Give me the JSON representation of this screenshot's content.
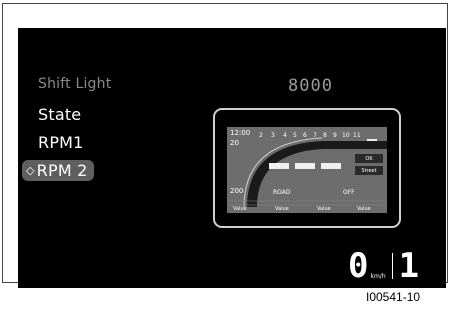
{
  "menu": {
    "items": [
      {
        "label": "Shift Light",
        "state": "dim"
      },
      {
        "label": "State",
        "state": "normal"
      },
      {
        "label": "RPM1",
        "state": "normal"
      },
      {
        "label": "RPM 2",
        "state": "selected"
      }
    ],
    "selected_marker": "◇"
  },
  "readout": {
    "value": "8000"
  },
  "preview": {
    "time": "12:00",
    "temp_top": "20",
    "temp_bottom": "200",
    "rpm_ticks": [
      "2",
      "3",
      "4",
      "5",
      "6",
      "7",
      "8",
      "9",
      "10",
      "11"
    ],
    "ok_label": "OK",
    "street_label": "Street",
    "road_label": "ROAD",
    "off_label": "OFF",
    "footer_values": [
      "Value",
      "Value",
      "Value",
      "Value"
    ]
  },
  "status": {
    "speed": "0",
    "unit": "km/h",
    "gear": "1"
  },
  "caption": "I00541-10",
  "colors": {
    "screen_bg": "#000000",
    "selected_bg": "#5f5f5f",
    "dim_text": "#8a8a8a"
  }
}
